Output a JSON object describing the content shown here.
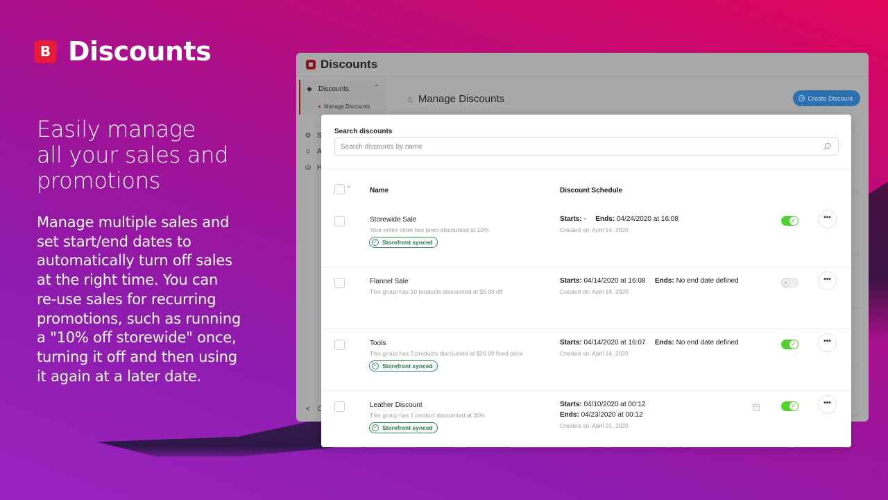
{
  "marketing": {
    "brand_logo_letter": "B",
    "brand_name": "Discounts",
    "headline_lines": [
      "Easily manage",
      "all your sales and",
      "promotions"
    ],
    "body_lines": [
      "Manage multiple sales and",
      "set start/end dates to",
      "automatically turn off sales",
      "at the right time. You can",
      "re-use sales for recurring",
      "promotions, such as running",
      "a \"10% off storewide\" once,",
      "turning it off and then using",
      "it again at a later date."
    ]
  },
  "app": {
    "title": "Discounts",
    "sidebar": {
      "group_label": "Discounts",
      "group_icon": "tag-icon",
      "sub_item": "Manage Discounts",
      "items": [
        {
          "label": "S",
          "icon": "gear-icon"
        },
        {
          "label": "A",
          "icon": "user-icon"
        },
        {
          "label": "H",
          "icon": "help-icon"
        }
      ],
      "back_label": "C"
    },
    "page_title": "Manage Discounts",
    "create_button": "Create Discount"
  },
  "modal": {
    "search_label": "Search discounts",
    "search_placeholder": "Search discounts by name",
    "search_value": "",
    "columns": {
      "name": "Name",
      "schedule": "Discount Schedule"
    },
    "rows": [
      {
        "name": "Storewide Sale",
        "description": "Your entire store has been discounted at 10%",
        "badge": "Storefront synced",
        "starts_label": "Starts:",
        "starts": "-",
        "ends_label": "Ends:",
        "ends": "04/24/2020 at 16:08",
        "created": "Created on: April 14, 2020",
        "enabled": true,
        "more": "•••"
      },
      {
        "name": "Flannel Sale",
        "description": "This group has 10 products discounted at $5.00 off",
        "badge": null,
        "starts_label": "Starts:",
        "starts": "04/14/2020 at 16:08",
        "ends_label": "Ends:",
        "ends": "No end date defined",
        "created": "Created on: April 14, 2020",
        "enabled": false,
        "more": "•••"
      },
      {
        "name": "Tools",
        "description": "This group has 2 products discounted at $20.00 fixed price",
        "badge": "Storefront synced",
        "starts_label": "Starts:",
        "starts": "04/14/2020 at 16:07",
        "ends_label": "Ends:",
        "ends": "No end date defined",
        "created": "Created on: April 14, 2020",
        "enabled": true,
        "more": "•••"
      },
      {
        "name": "Leather Discount",
        "description": "This group has 1 product discounted at 30%",
        "badge": "Storefront synced",
        "starts_label": "Starts:",
        "starts": "04/10/2020 at 00:12",
        "ends_label": "Ends:",
        "ends": "04/23/2020 at 00:12",
        "created": "Created on: April 01, 2020",
        "enabled": true,
        "more": "•••"
      }
    ]
  },
  "colors": {
    "brand_red": "#e8193b",
    "toggle_on": "#4fd22e",
    "badge_green": "#227a47",
    "create_button": "#2d70ad"
  }
}
